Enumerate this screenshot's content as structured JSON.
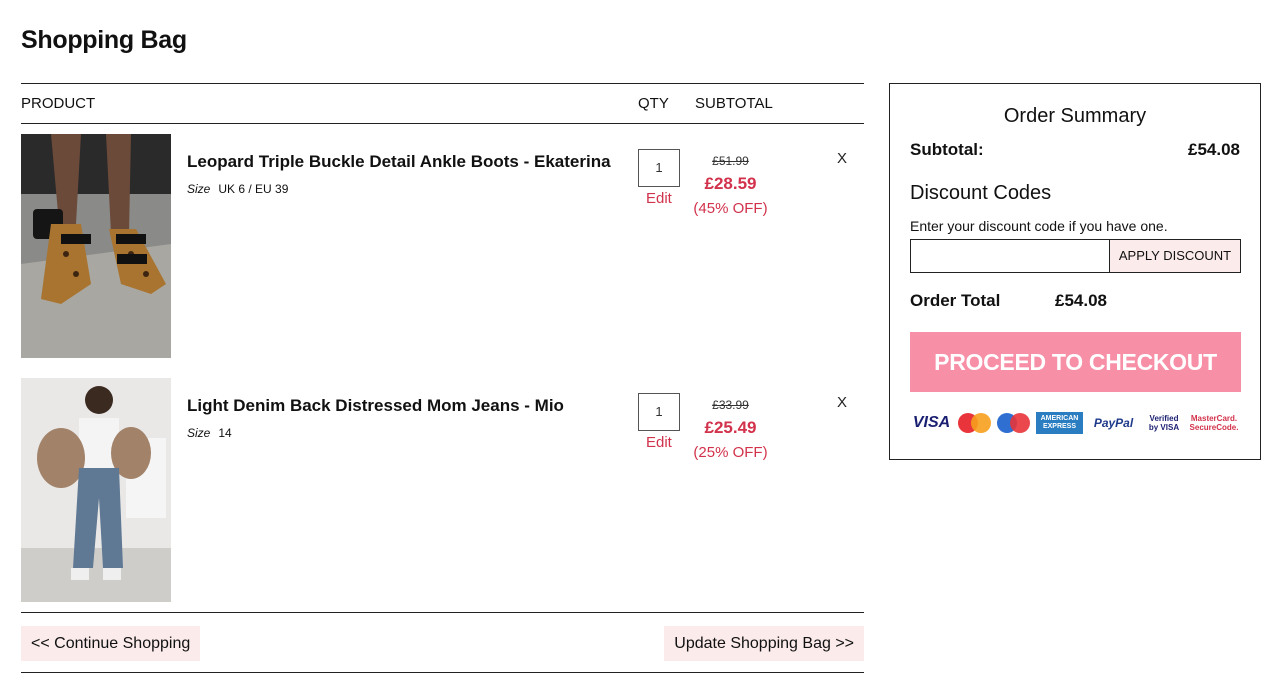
{
  "page": {
    "title": "Shopping Bag"
  },
  "cart": {
    "headers": {
      "product": "PRODUCT",
      "qty": "QTY",
      "subtotal": "SUBTOTAL"
    },
    "items": [
      {
        "name": "Leopard Triple Buckle Detail Ankle Boots - Ekaterina",
        "size_label": "Size",
        "size_value": "UK 6 / EU 39",
        "qty": "1",
        "edit_label": "Edit",
        "price_old": "£51.99",
        "price_new": "£28.59",
        "discount": "(45% OFF)",
        "remove_label": "X"
      },
      {
        "name": "Light Denim Back Distressed Mom Jeans - Mio",
        "size_label": "Size",
        "size_value": "14",
        "qty": "1",
        "edit_label": "Edit",
        "price_old": "£33.99",
        "price_new": "£25.49",
        "discount": "(25% OFF)",
        "remove_label": "X"
      }
    ],
    "continue_label": "<< Continue Shopping",
    "update_label": "Update Shopping Bag >>"
  },
  "summary": {
    "title": "Order Summary",
    "subtotal_label": "Subtotal:",
    "subtotal_value": "£54.08",
    "discount_title": "Discount Codes",
    "discount_hint": "Enter your discount code if you have one.",
    "discount_value": "",
    "apply_label": "APPLY DISCOUNT",
    "total_label": "Order Total",
    "total_value": "£54.08",
    "checkout_label": "PROCEED TO CHECKOUT",
    "payments": {
      "visa": "VISA",
      "amex": "AMERICAN EXPRESS",
      "paypal": "PayPal",
      "vbv": "Verified by VISA",
      "mcsc": "MasterCard. SecureCode."
    }
  },
  "colors": {
    "accent": "#d2324b",
    "checkout": "#f78fa7",
    "light_button": "#fbebeb"
  }
}
